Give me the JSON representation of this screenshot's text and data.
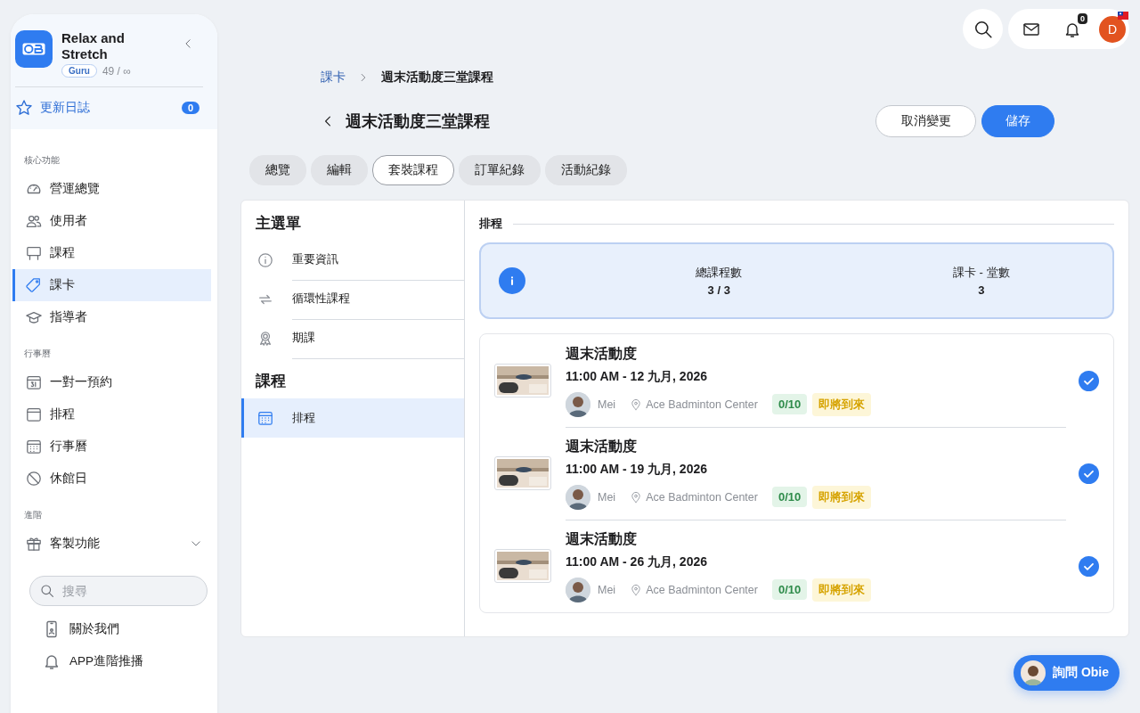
{
  "sidebar": {
    "brand": {
      "name": "Relax and Stretch",
      "plan": "Guru",
      "usage": "49 / ∞"
    },
    "changelog": {
      "label": "更新日誌",
      "count": "0"
    },
    "sections": [
      {
        "heading": "核心功能",
        "items": [
          {
            "label": "營運總覽",
            "selected": false
          },
          {
            "label": "使用者",
            "selected": false
          },
          {
            "label": "課程",
            "selected": false
          },
          {
            "label": "課卡",
            "selected": true
          },
          {
            "label": "指導者",
            "selected": false
          }
        ]
      },
      {
        "heading": "行事曆",
        "items": [
          {
            "label": "一對一預約",
            "selected": false
          },
          {
            "label": "排程",
            "selected": false
          },
          {
            "label": "行事曆",
            "selected": false
          },
          {
            "label": "休館日",
            "selected": false
          }
        ]
      },
      {
        "heading": "進階",
        "items": [
          {
            "label": "客製功能",
            "selected": false,
            "expanded": true
          }
        ]
      }
    ],
    "search": {
      "placeholder": "搜尋"
    },
    "sub_items": [
      {
        "label": "關於我們"
      },
      {
        "label": "APP進階推播"
      }
    ]
  },
  "topbar": {
    "notification_count": "0",
    "avatar_initial": "D"
  },
  "breadcrumb": [
    "課卡",
    "週末活動度三堂課程"
  ],
  "page_title": "週末活動度三堂課程",
  "buttons": [
    {
      "label": "取消變更",
      "kind": "secondary"
    },
    {
      "label": "儲存",
      "kind": "primary"
    }
  ],
  "tabs": [
    {
      "label": "總覽",
      "selected": false
    },
    {
      "label": "編輯",
      "selected": false
    },
    {
      "label": "套裝課程",
      "selected": true
    },
    {
      "label": "訂單紀錄",
      "selected": false
    },
    {
      "label": "活動紀錄",
      "selected": false
    }
  ],
  "menu": {
    "sections": [
      {
        "heading": "主選單",
        "items": [
          {
            "label": "重要資訊",
            "selected": false
          },
          {
            "label": "循環性課程",
            "selected": false
          },
          {
            "label": "期課",
            "selected": false
          }
        ]
      },
      {
        "heading": "課程",
        "items": [
          {
            "label": "排程",
            "selected": true
          }
        ]
      }
    ]
  },
  "schedule": {
    "heading": "排程",
    "summary": [
      {
        "label": "總課程數",
        "value": "3 / 3"
      },
      {
        "label": "課卡 - 堂數",
        "value": "3"
      }
    ],
    "sessions": [
      {
        "title": "週末活動度",
        "time": "11:00 AM - 12 九月, 2026",
        "instructor": "Mei",
        "location": "Ace Badminton Center",
        "capacity": "0/10",
        "status": "即將到來",
        "checked": true
      },
      {
        "title": "週末活動度",
        "time": "11:00 AM - 19 九月, 2026",
        "instructor": "Mei",
        "location": "Ace Badminton Center",
        "capacity": "0/10",
        "status": "即將到來",
        "checked": true
      },
      {
        "title": "週末活動度",
        "time": "11:00 AM - 26 九月, 2026",
        "instructor": "Mei",
        "location": "Ace Badminton Center",
        "capacity": "0/10",
        "status": "即將到來",
        "checked": true
      }
    ]
  },
  "assistant": {
    "label": "詢問 Obie"
  }
}
